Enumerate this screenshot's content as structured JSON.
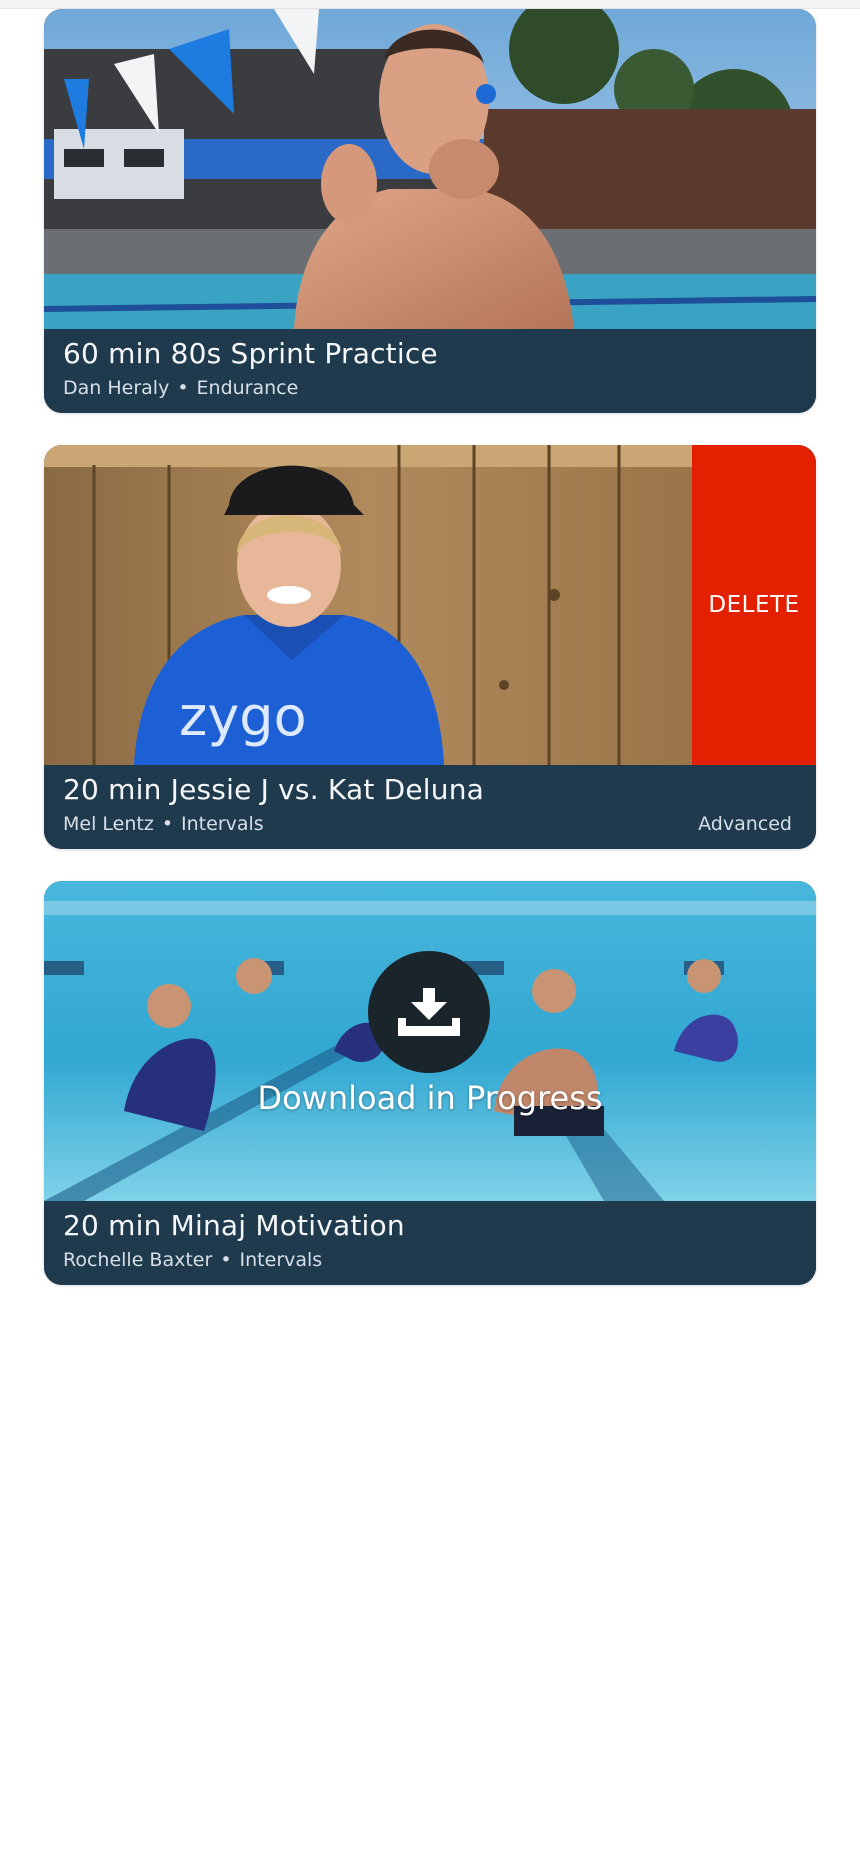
{
  "workouts": [
    {
      "title": "60 min 80s Sprint Practice",
      "coach": "Dan Heraly",
      "category": "Endurance",
      "thumbnail": "swimmer with headphones at outdoor pool"
    },
    {
      "title": "20 min Jessie J vs. Kat Deluna",
      "coach": "Mel Lentz",
      "category": "Intervals",
      "level": "Advanced",
      "thumbnail": "smiling woman in blue zygo hoodie and cap",
      "hoodie_logo": "zygo",
      "swipe_action": "DELETE"
    },
    {
      "title": "20 min Minaj Motivation",
      "coach": "Rochelle Baxter",
      "category": "Intervals",
      "thumbnail": "group of swimmers underwater in pool",
      "download_status": "Download in Progress"
    }
  ],
  "separator": "•",
  "icons": {
    "download": "download-icon"
  },
  "colors": {
    "card_bg": "#1f3a4d",
    "delete": "#e32000",
    "title_text": "#f4f6f8",
    "meta_text": "#d7dfe6"
  }
}
